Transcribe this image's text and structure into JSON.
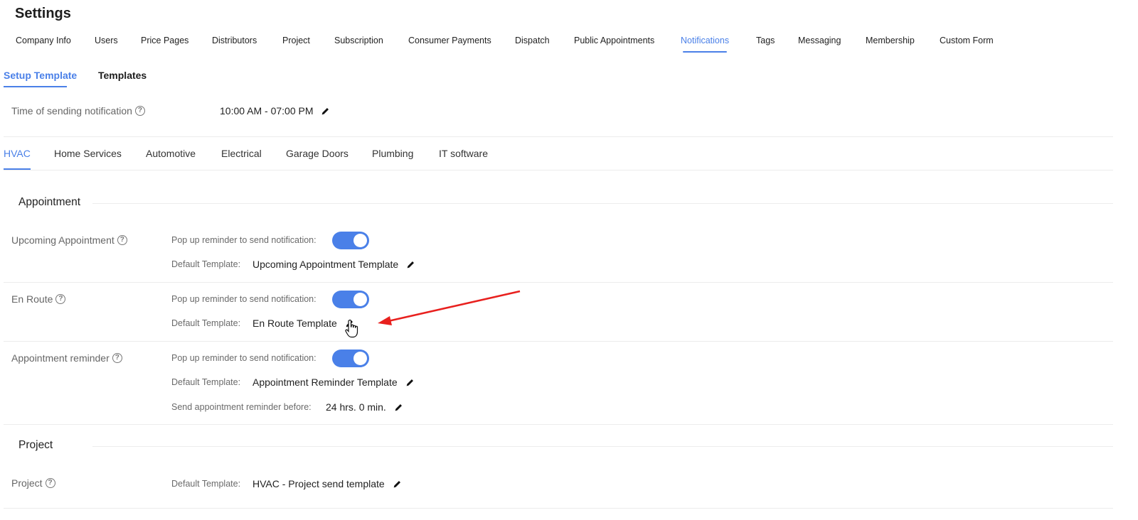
{
  "page": {
    "title": "Settings"
  },
  "main_tabs": [
    {
      "label": "Company Info"
    },
    {
      "label": "Users"
    },
    {
      "label": "Price Pages"
    },
    {
      "label": "Distributors"
    },
    {
      "label": "Project"
    },
    {
      "label": "Subscription"
    },
    {
      "label": "Consumer Payments"
    },
    {
      "label": "Dispatch"
    },
    {
      "label": "Public Appointments"
    },
    {
      "label": "Notifications",
      "active": true
    },
    {
      "label": "Tags"
    },
    {
      "label": "Messaging"
    },
    {
      "label": "Membership"
    },
    {
      "label": "Custom Form"
    }
  ],
  "sub_tabs": [
    {
      "label": "Setup Template",
      "active": true
    },
    {
      "label": "Templates"
    }
  ],
  "sending_time": {
    "label": "Time of sending notification",
    "value": "10:00 AM - 07:00 PM"
  },
  "category_tabs": [
    {
      "label": "HVAC",
      "active": true
    },
    {
      "label": "Home Services"
    },
    {
      "label": "Automotive"
    },
    {
      "label": "Electrical"
    },
    {
      "label": "Garage Doors"
    },
    {
      "label": "Plumbing"
    },
    {
      "label": "IT software"
    }
  ],
  "sections": {
    "appointment": {
      "title": "Appointment",
      "rows": [
        {
          "label": "Upcoming Appointment",
          "popup_label": "Pop up reminder to send notification:",
          "popup_enabled": true,
          "template_label": "Default Template:",
          "template_value": "Upcoming Appointment Template"
        },
        {
          "label": "En Route",
          "popup_label": "Pop up reminder to send notification:",
          "popup_enabled": true,
          "template_label": "Default Template:",
          "template_value": "En Route Template"
        },
        {
          "label": "Appointment reminder",
          "popup_label": "Pop up reminder to send notification:",
          "popup_enabled": true,
          "template_label": "Default Template:",
          "template_value": "Appointment Reminder Template",
          "reminder_label": "Send appointment reminder before:",
          "reminder_value": "24 hrs. 0 min."
        }
      ]
    },
    "project": {
      "title": "Project",
      "rows": [
        {
          "label": "Project",
          "template_label": "Default Template:",
          "template_value": "HVAC - Project send template"
        }
      ]
    }
  },
  "icons": {
    "help": "question-circle-icon",
    "edit": "pencil-icon",
    "cursor": "hand-pointer-icon",
    "annotation": "red-arrow"
  },
  "colors": {
    "accent": "#4a80e8",
    "annotation_arrow": "#e8201e",
    "toggle_on": "#4a80e8"
  }
}
